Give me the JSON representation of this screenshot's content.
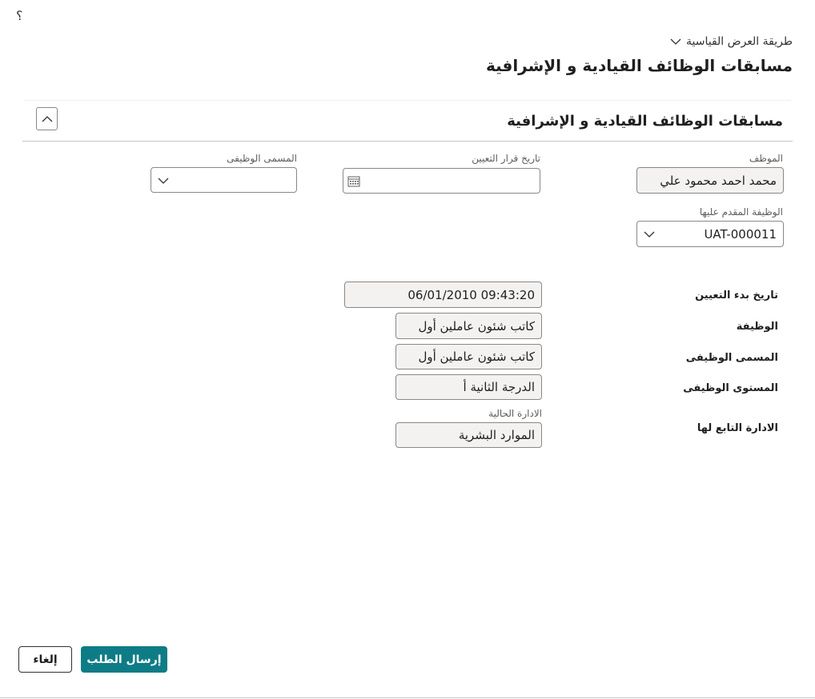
{
  "header": {
    "help_glyph": "؟",
    "view_mode_label": "طريقة العرض القياسية",
    "page_title": "مسابقات الوظائف القيادية و الإشرافية"
  },
  "section": {
    "title": "مسابقات الوظائف القيادية و الإشرافية"
  },
  "fields": {
    "employee_label": "الموظف",
    "employee_value": "محمد احمد محمود علي",
    "appointment_decision_date_label": "تاريخ قرار التعيين",
    "appointment_decision_date_value": "",
    "job_title_label": "المسمى الوظيفى",
    "job_title_value": "",
    "applied_job_label": "الوظيفة المقدم عليها",
    "applied_job_value": "UAT-000011"
  },
  "details": {
    "start_date_label": "تاريخ بدء التعيين",
    "start_date_value": "09:43:20 06/01/2010",
    "job_label": "الوظيفة",
    "job_value": "كاتب شئون عاملين أول",
    "title_label": "المسمى الوظيفى",
    "title_value": "كاتب شئون عاملين أول",
    "level_label": "المستوى الوظيفى",
    "level_value": "الدرجة الثانية أ",
    "department_label": "الادارة التابع لها",
    "current_department_label": "الادارة الحالية",
    "department_value": "الموارد البشرية"
  },
  "actions": {
    "submit_label": "إرسال الطلب",
    "cancel_label": "إلغاء"
  },
  "colors": {
    "accent": "#0e7c86",
    "readonly_bg": "#f3f2f1",
    "border": "#8a8886"
  },
  "icons": [
    "help-icon",
    "chevron-down-icon",
    "chevron-up-icon",
    "calendar-icon"
  ]
}
